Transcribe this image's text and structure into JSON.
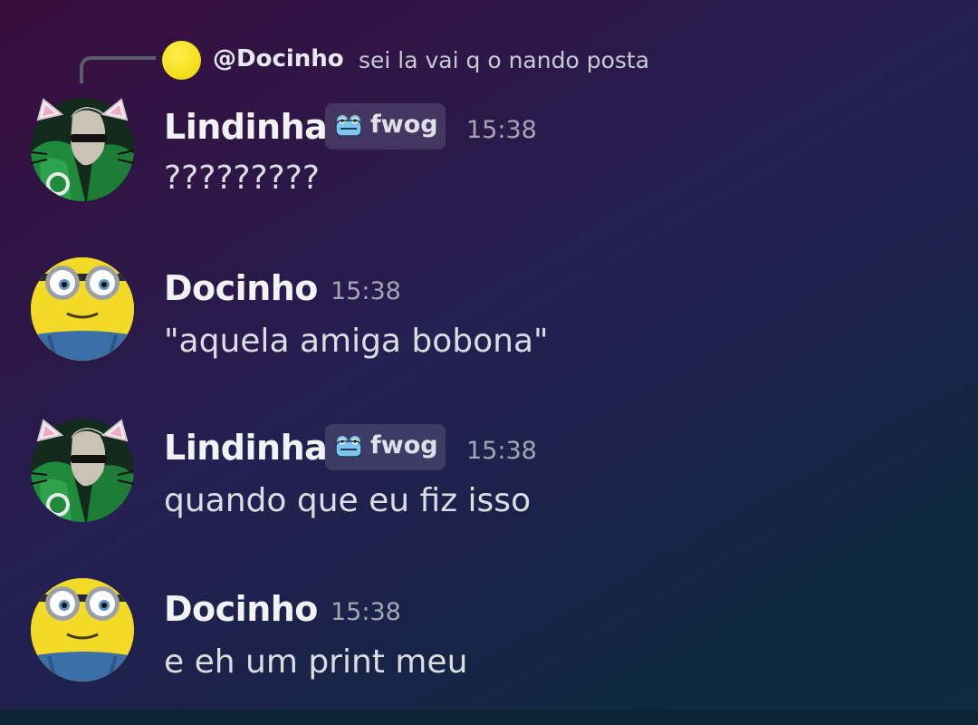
{
  "reply": {
    "author": "@Docinho",
    "text": "sei la vai q o nando posta"
  },
  "messages": [
    {
      "author": "Lindinha",
      "tag": "fwog",
      "time": "15:38",
      "content": "?????????",
      "avatar": "cat-ears-green-jacket-avatar"
    },
    {
      "author": "Docinho",
      "time": "15:38",
      "content": "\"aquela amiga bobona\"",
      "avatar": "minion-avatar"
    },
    {
      "author": "Lindinha",
      "tag": "fwog",
      "time": "15:38",
      "content": "quando que eu fiz isso",
      "avatar": "cat-ears-green-jacket-avatar"
    },
    {
      "author": "Docinho",
      "time": "15:38",
      "content": "e eh um print meu",
      "avatar": "minion-avatar"
    }
  ],
  "colors": {
    "background_start": "#3a0d3e",
    "background_end": "#0b2a40",
    "author_text": "#f2f3f5",
    "message_text": "#dcdde3",
    "timestamp_text": "#a4a7b3"
  }
}
